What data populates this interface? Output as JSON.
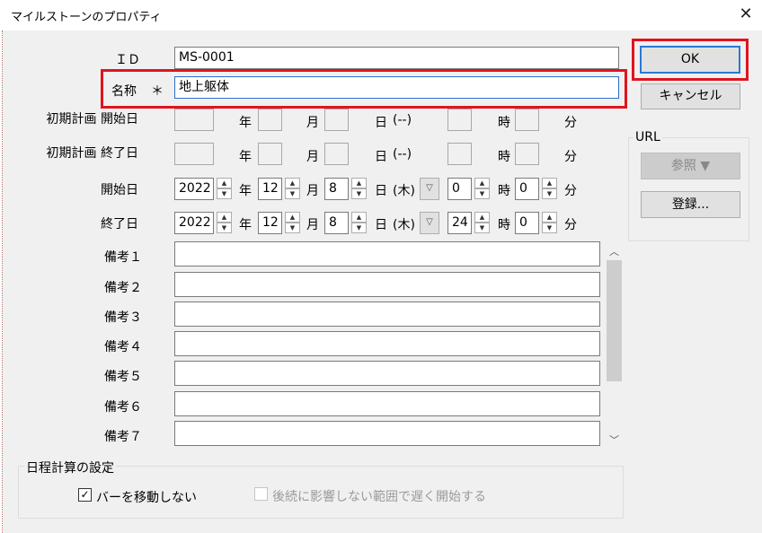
{
  "window": {
    "title": "マイルストーンのプロパティ",
    "close_glyph": "✕"
  },
  "id_row": {
    "label": "ＩＤ",
    "value": "MS-0001"
  },
  "name_row": {
    "label": "名称",
    "required_mark": "＊",
    "value": "地上躯体"
  },
  "units": {
    "year": "年",
    "month": "月",
    "day": "日",
    "hour": "時",
    "minute": "分"
  },
  "initial_start": {
    "label": "初期計画 開始日",
    "weekday": "(--)"
  },
  "initial_end": {
    "label": "初期計画 終了日",
    "weekday": "(--)"
  },
  "start": {
    "label": "開始日",
    "year": "2022",
    "month": "12",
    "day": "8",
    "weekday": "(木)",
    "hour": "0",
    "minute": "0"
  },
  "end": {
    "label": "終了日",
    "year": "2022",
    "month": "12",
    "day": "8",
    "weekday": "(木)",
    "hour": "24",
    "minute": "0"
  },
  "notes": [
    {
      "label": "備考１",
      "value": ""
    },
    {
      "label": "備考２",
      "value": ""
    },
    {
      "label": "備考３",
      "value": ""
    },
    {
      "label": "備考４",
      "value": ""
    },
    {
      "label": "備考５",
      "value": ""
    },
    {
      "label": "備考６",
      "value": ""
    },
    {
      "label": "備考７",
      "value": ""
    }
  ],
  "buttons": {
    "ok": "OK",
    "cancel": "キャンセル"
  },
  "url_group": {
    "title": "URL",
    "browse": "参照 ▼",
    "register": "登録..."
  },
  "schedule_group": {
    "title": "日程計算の設定",
    "no_move_bar": {
      "label": "バーを移動しない",
      "checked": true
    },
    "late_start": {
      "label": "後続に影響しない範囲で遅く開始する",
      "checked": false,
      "enabled": false
    }
  },
  "colors": {
    "highlight": "#e0141e",
    "focus_border": "#2a6fc9"
  }
}
